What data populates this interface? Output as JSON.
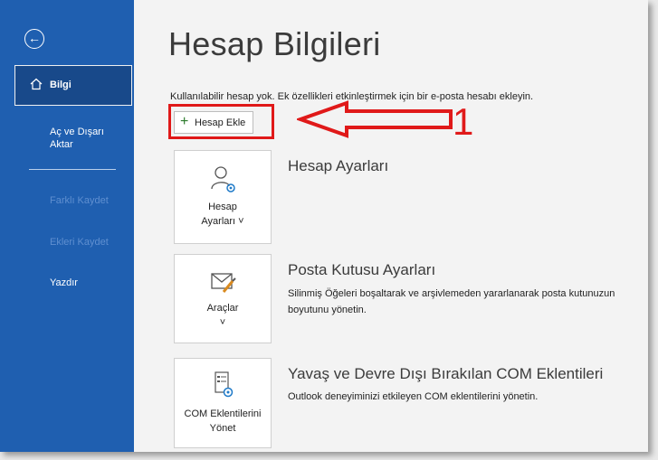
{
  "sidebar": {
    "back_icon": "arrow-left-circle-icon",
    "items": [
      {
        "label": "Bilgi",
        "icon": "home-icon"
      },
      {
        "label": "Aç ve Dışarı Aktar"
      },
      {
        "label": "Farklı Kaydet"
      },
      {
        "label": "Ekleri Kaydet"
      },
      {
        "label": "Yazdır"
      }
    ]
  },
  "main": {
    "title": "Hesap Bilgileri",
    "info_text": "Kullanılabilir hesap yok. Ek özellikleri etkinleştirmek için bir e-posta hesabı ekleyin.",
    "add_account_label": "Hesap Ekle",
    "annotation_number": "1",
    "annotation_color": "#e01919",
    "sections": [
      {
        "tile_line1": "Hesap",
        "tile_line2": "Ayarları ˅",
        "tile_icon": "account-settings-icon",
        "title": "Hesap Ayarları",
        "description": ""
      },
      {
        "tile_line1": "Araçlar",
        "tile_line2": "˅",
        "tile_icon": "mailbox-tools-icon",
        "title": "Posta Kutusu Ayarları",
        "description": "Silinmiş Öğeleri boşaltarak ve arşivlemeden yararlanarak posta kutunuzun boyutunu yönetin."
      },
      {
        "tile_line1": "COM Eklentilerini",
        "tile_line2": "Yönet",
        "tile_icon": "com-addins-icon",
        "title": "Yavaş ve Devre Dışı Bırakılan COM Eklentileri",
        "description": "Outlook deneyiminizi etkileyen COM eklentilerini yönetin."
      }
    ]
  },
  "colors": {
    "sidebar": "#1f5fb0",
    "sidebar_active": "#18498a"
  }
}
